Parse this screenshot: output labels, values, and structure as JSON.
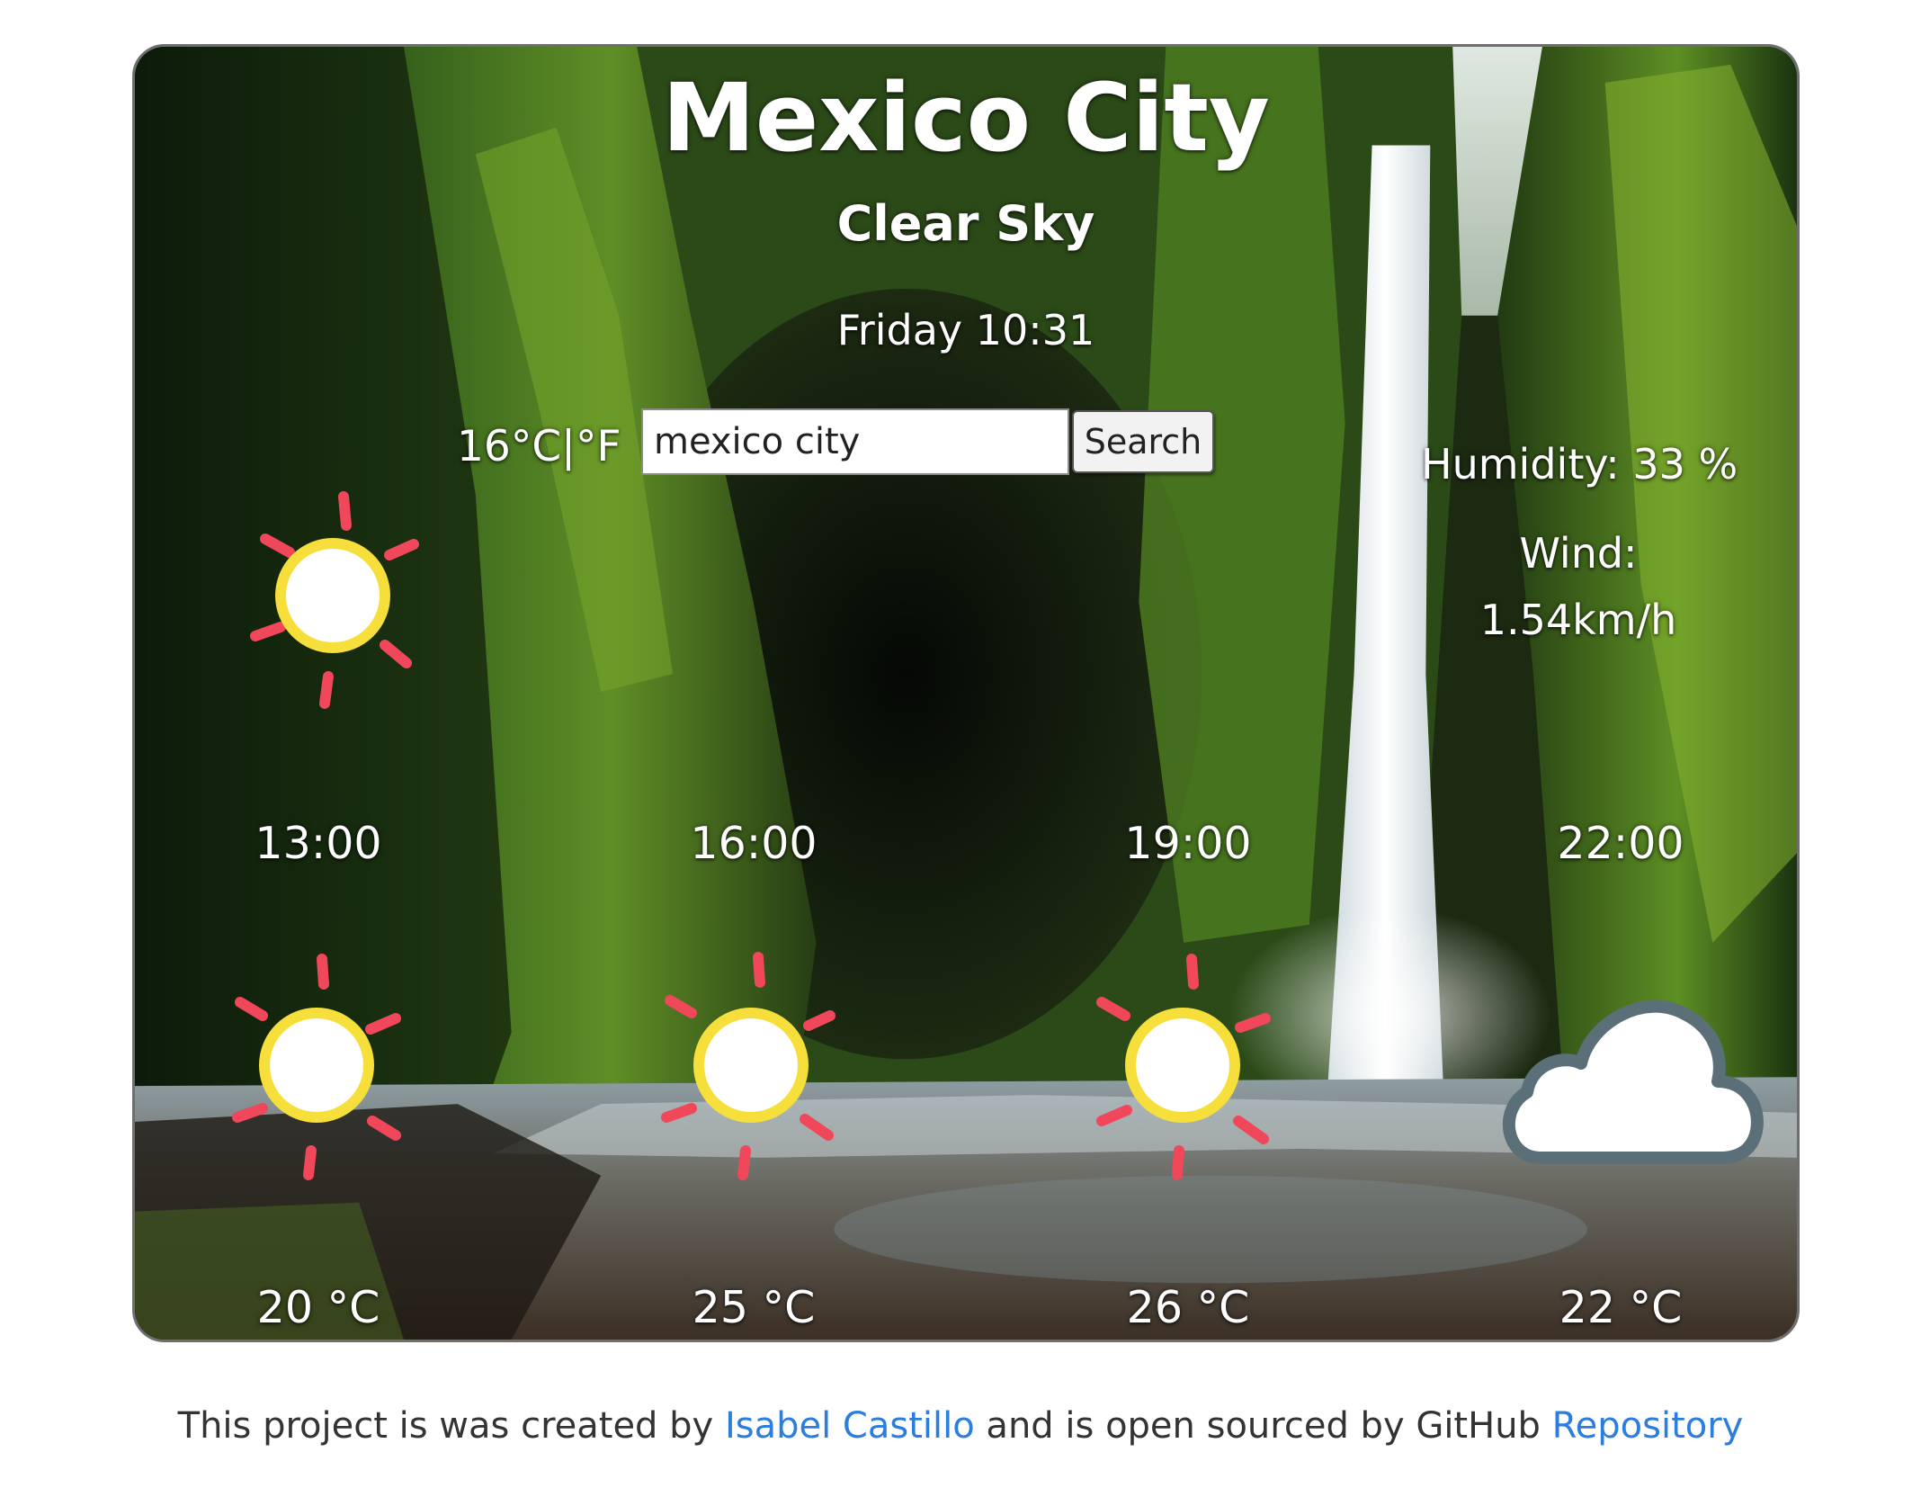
{
  "weather": {
    "city": "Mexico City",
    "description": "Clear Sky",
    "datetime": "Friday 10:31",
    "temperature": "16",
    "unit_celsius": "°C",
    "unit_separator": "|",
    "unit_fahrenheit": "°F",
    "current_icon": "sun-icon"
  },
  "search": {
    "value": "mexico city",
    "button_label": "Search"
  },
  "details": {
    "humidity": "Humidity: 33 %",
    "wind_label": "Wind:",
    "wind_value": "1.54km/h"
  },
  "forecast": [
    {
      "time": "13:00",
      "icon": "sun-icon",
      "temp": "20 °C"
    },
    {
      "time": "16:00",
      "icon": "sun-icon",
      "temp": "25 °C"
    },
    {
      "time": "19:00",
      "icon": "sun-icon",
      "temp": "26 °C"
    },
    {
      "time": "22:00",
      "icon": "cloud-icon",
      "temp": "22 °C"
    }
  ],
  "footer": {
    "prefix": "This project is was created by ",
    "author_link": "Isabel Castillo",
    "middle": " and is open sourced by GitHub ",
    "repo_link": "Repository"
  },
  "colors": {
    "link": "#2b7de0",
    "sun_ray": "#f0475a",
    "sun_ring": "#f7df3b",
    "cloud_outline": "#5b6f78"
  }
}
